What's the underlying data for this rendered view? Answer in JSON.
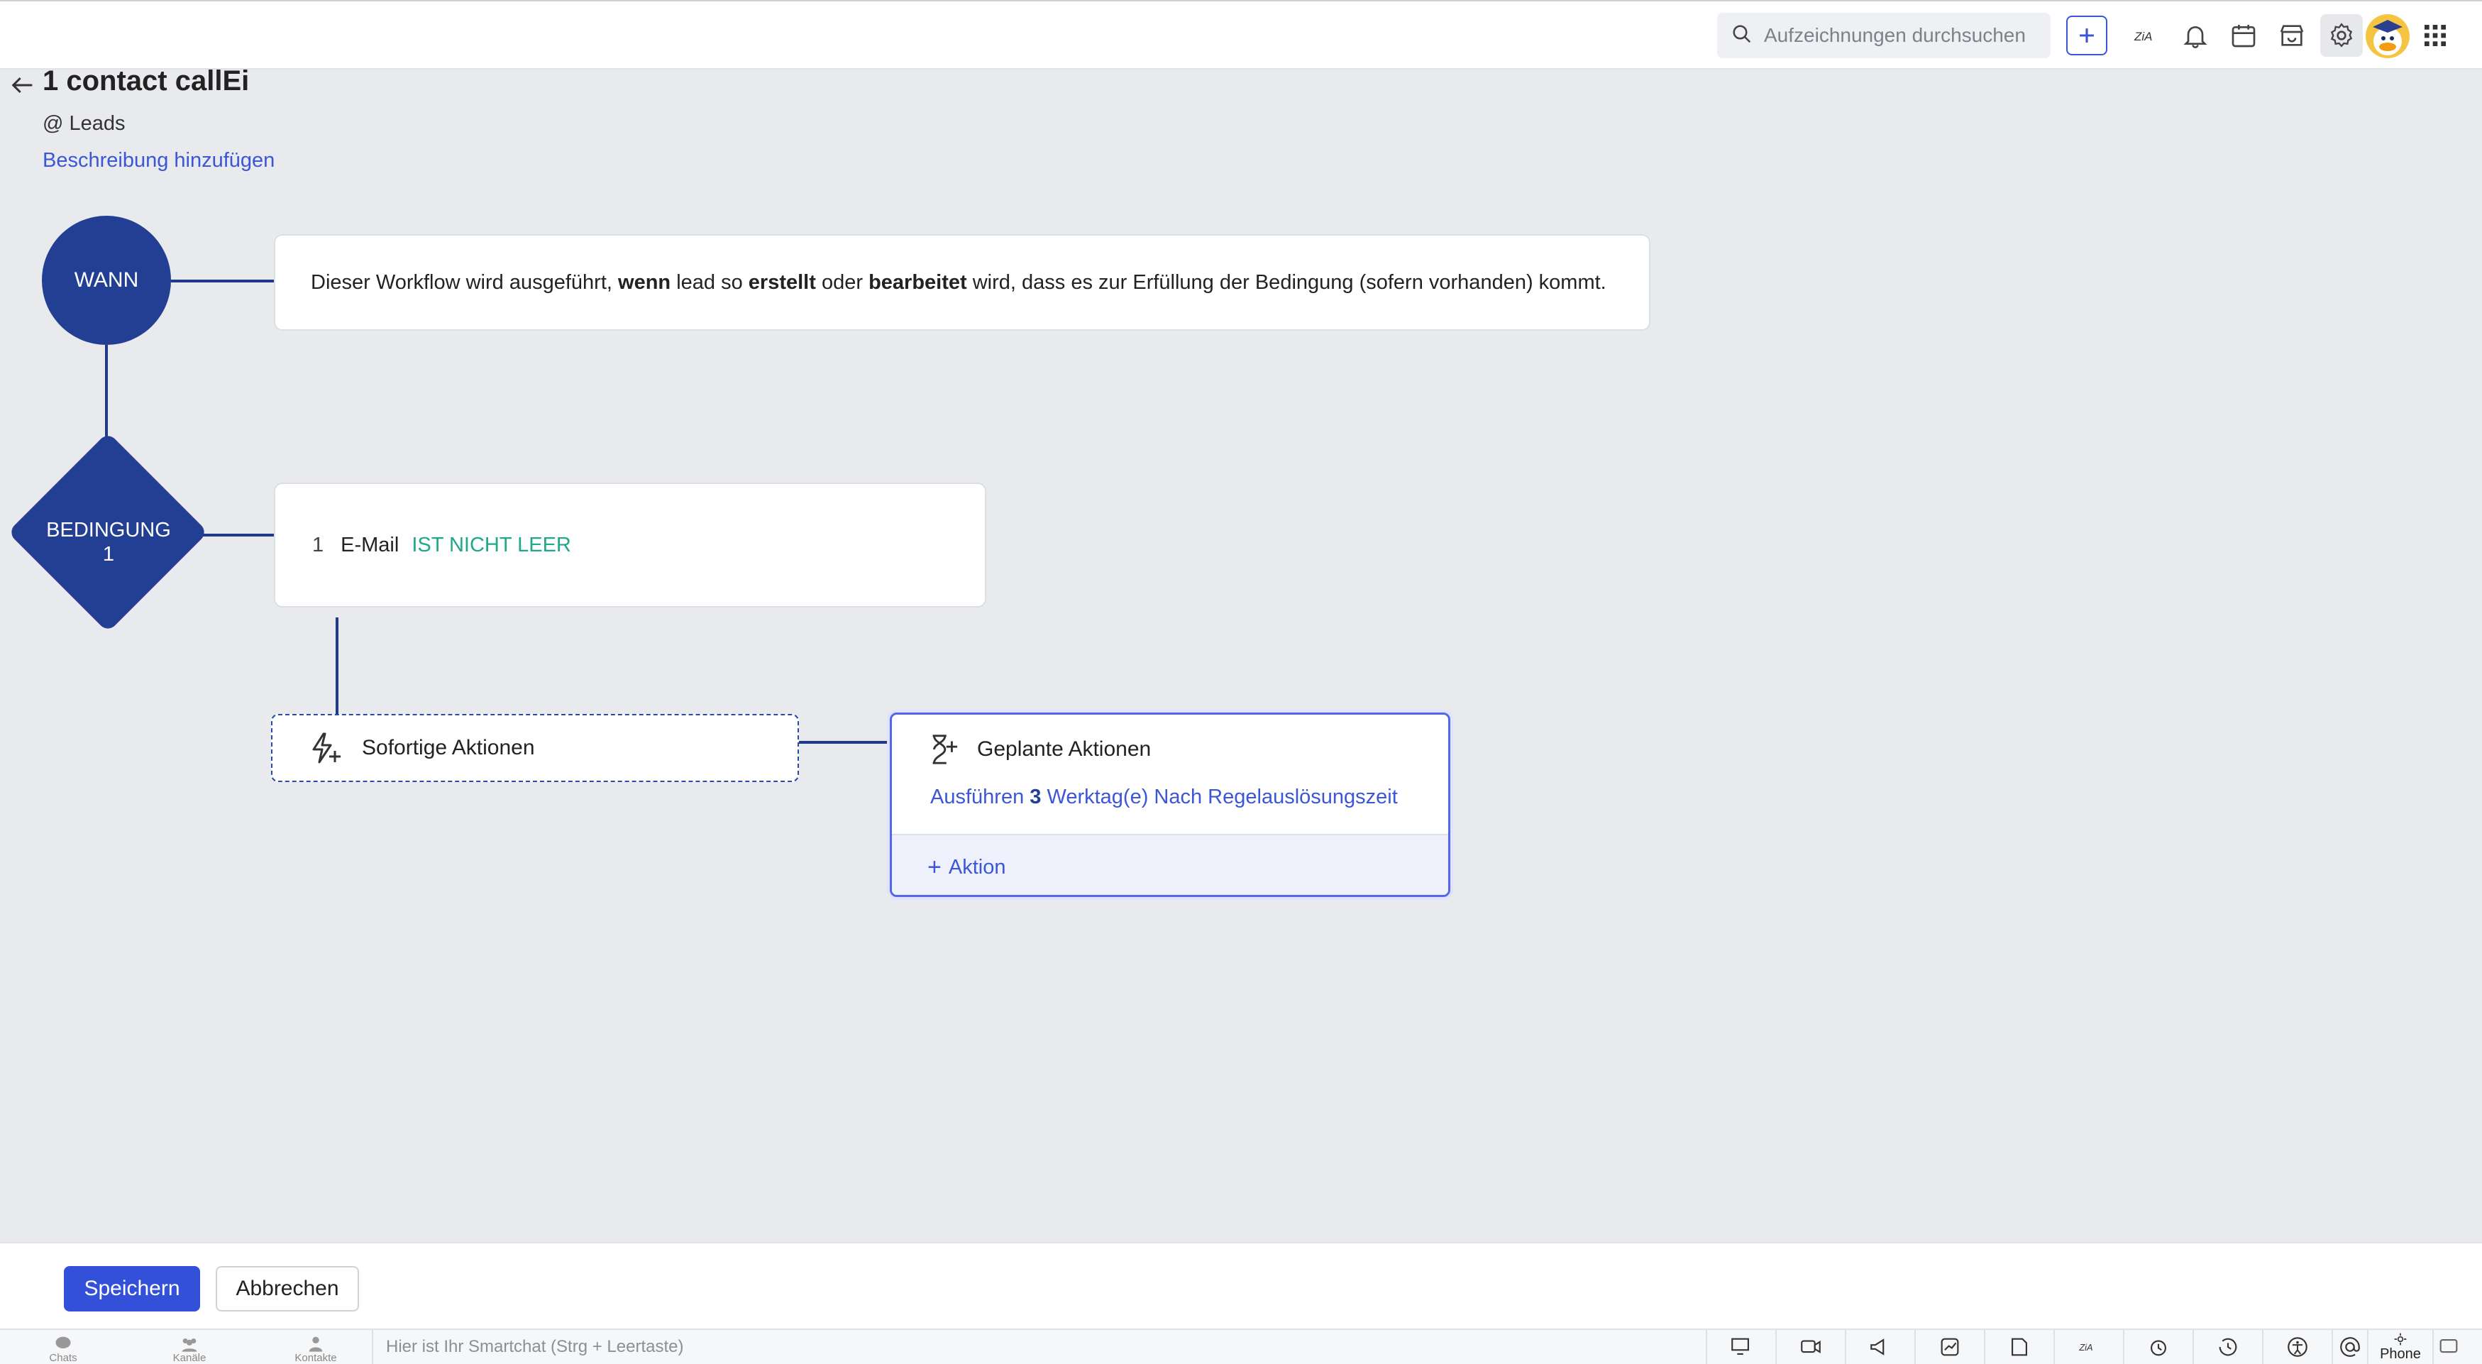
{
  "topbar": {
    "search_placeholder": "Aufzeichnungen durchsuchen",
    "icons": [
      "search-icon",
      "plus-icon",
      "zia-icon",
      "bell-icon",
      "calendar-icon",
      "marketplace-icon",
      "gear-icon",
      "avatar",
      "apps-grid-icon"
    ]
  },
  "header": {
    "title": "1 contact callEi",
    "module": "@ Leads",
    "add_description": "Beschreibung hinzufügen"
  },
  "workflow": {
    "when_node": "WANN",
    "when_text": {
      "p1": "Dieser Workflow wird ausgeführt, ",
      "b1": "wenn",
      "p2": " lead so ",
      "b2": "erstellt",
      "p3": " oder ",
      "b3": "bearbeitet",
      "p4": " wird, dass es zur Erfüllung der Bedingung (sofern vorhanden) kommt."
    },
    "condition_node": {
      "line1": "BEDINGUNG",
      "line2": "1"
    },
    "condition": {
      "index": "1",
      "field": "E-Mail",
      "operator": "IST NICHT LEER"
    },
    "instant_actions": "Sofortige Aktionen",
    "scheduled": {
      "title": "Geplante Aktionen",
      "prefix": "Ausführen",
      "count": "3",
      "suffix": "Werktag(e) Nach Regelauslösungszeit",
      "add_action": "Aktion"
    }
  },
  "actions": {
    "save": "Speichern",
    "cancel": "Abbrechen"
  },
  "statusbar": {
    "tabs": [
      "Chats",
      "Kanäle",
      "Kontakte"
    ],
    "smartchat_placeholder": "Hier ist Ihr Smartchat (Strg + Leertaste)",
    "phone": "Phone"
  },
  "colors": {
    "primary": "#223f93",
    "accent": "#3b56d6",
    "condition_operator": "#1fa88a",
    "save_button": "#3350d8"
  }
}
